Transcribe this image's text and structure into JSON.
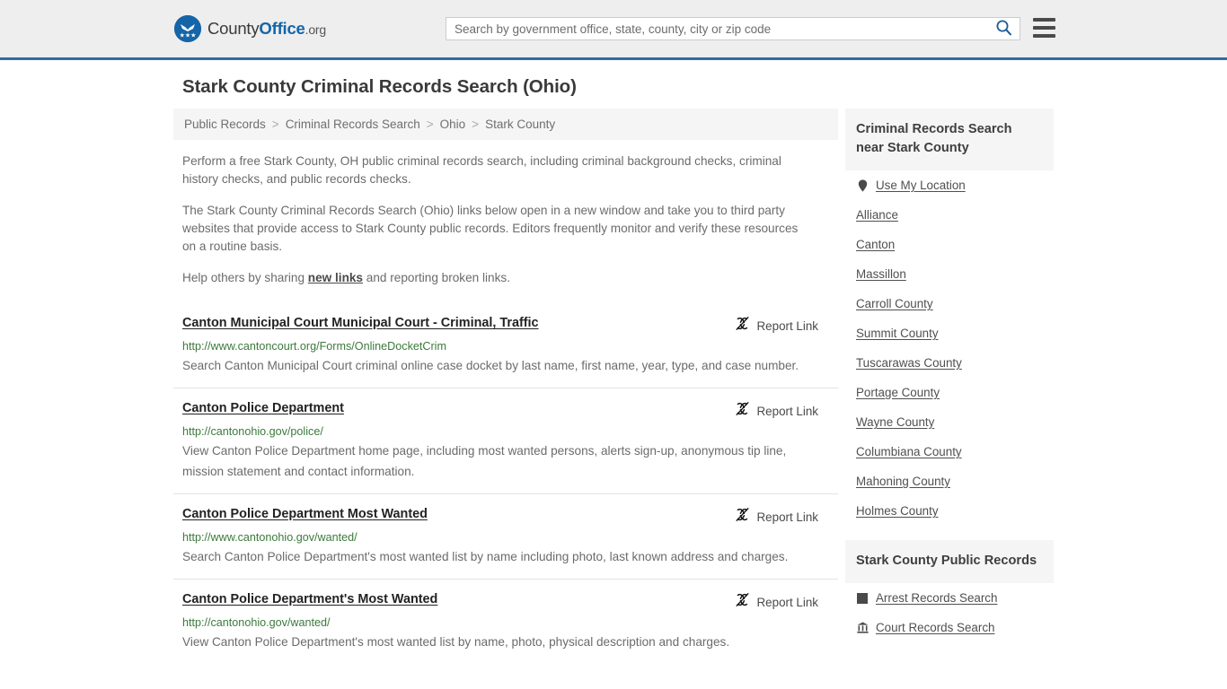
{
  "header": {
    "brand": {
      "prefix": "County",
      "bold": "Office",
      "tld": ".org",
      "logo_icon": "eagle-stars-logo-icon"
    },
    "search": {
      "placeholder": "Search by government office, state, county, city or zip code",
      "value": "",
      "button_icon": "search-icon"
    },
    "menu_icon": "hamburger-menu-icon",
    "accent_color": "#2e6da4",
    "background_color": "#eeeeee"
  },
  "page": {
    "title": "Stark County Criminal Records Search (Ohio)"
  },
  "breadcrumb": {
    "separator": ">",
    "items": [
      {
        "label": "Public Records"
      },
      {
        "label": "Criminal Records Search"
      },
      {
        "label": "Ohio"
      },
      {
        "label": "Stark County"
      }
    ]
  },
  "intro": {
    "paragraph_1": "Perform a free Stark County, OH public criminal records search, including criminal background checks, criminal history checks, and public records checks.",
    "paragraph_2": "The Stark County Criminal Records Search (Ohio) links below open in a new window and take you to third party websites that provide access to Stark County public records. Editors frequently monitor and verify these resources on a routine basis.",
    "paragraph_3_before": "Help others by sharing ",
    "paragraph_3_link": "new links",
    "paragraph_3_after": " and reporting broken links."
  },
  "results": {
    "report_label": "Report Link",
    "report_icon": "broken-link-icon",
    "url_color": "#3b7a3b",
    "items": [
      {
        "title": "Canton Municipal Court Municipal Court - Criminal, Traffic",
        "url": "http://www.cantoncourt.org/Forms/OnlineDocketCrim",
        "description": "Search Canton Municipal Court criminal online case docket by last name, first name, year, type, and case number."
      },
      {
        "title": "Canton Police Department",
        "url": "http://cantonohio.gov/police/",
        "description": "View Canton Police Department home page, including most wanted persons, alerts sign-up, anonymous tip line, mission statement and contact information."
      },
      {
        "title": "Canton Police Department Most Wanted",
        "url": "http://www.cantonohio.gov/wanted/",
        "description": "Search Canton Police Department's most wanted list by name including photo, last known address and charges."
      },
      {
        "title": "Canton Police Department's Most Wanted",
        "url": "http://cantonohio.gov/wanted/",
        "description": "View Canton Police Department's most wanted list by name, photo, physical description and charges."
      }
    ]
  },
  "sidebar": {
    "nearby": {
      "heading": "Criminal Records Search near Stark County",
      "items": [
        {
          "label": "Use My Location",
          "icon": "map-pin-icon"
        },
        {
          "label": "Alliance",
          "icon": ""
        },
        {
          "label": "Canton",
          "icon": ""
        },
        {
          "label": "Massillon",
          "icon": ""
        },
        {
          "label": "Carroll County",
          "icon": ""
        },
        {
          "label": "Summit County",
          "icon": ""
        },
        {
          "label": "Tuscarawas County",
          "icon": ""
        },
        {
          "label": "Portage County",
          "icon": ""
        },
        {
          "label": "Wayne County",
          "icon": ""
        },
        {
          "label": "Columbiana County",
          "icon": ""
        },
        {
          "label": "Mahoning County",
          "icon": ""
        },
        {
          "label": "Holmes County",
          "icon": ""
        }
      ]
    },
    "public_records": {
      "heading": "Stark County Public Records",
      "items": [
        {
          "label": "Arrest Records Search",
          "icon": "square-icon"
        },
        {
          "label": "Court Records Search",
          "icon": "courthouse-icon"
        }
      ]
    }
  }
}
